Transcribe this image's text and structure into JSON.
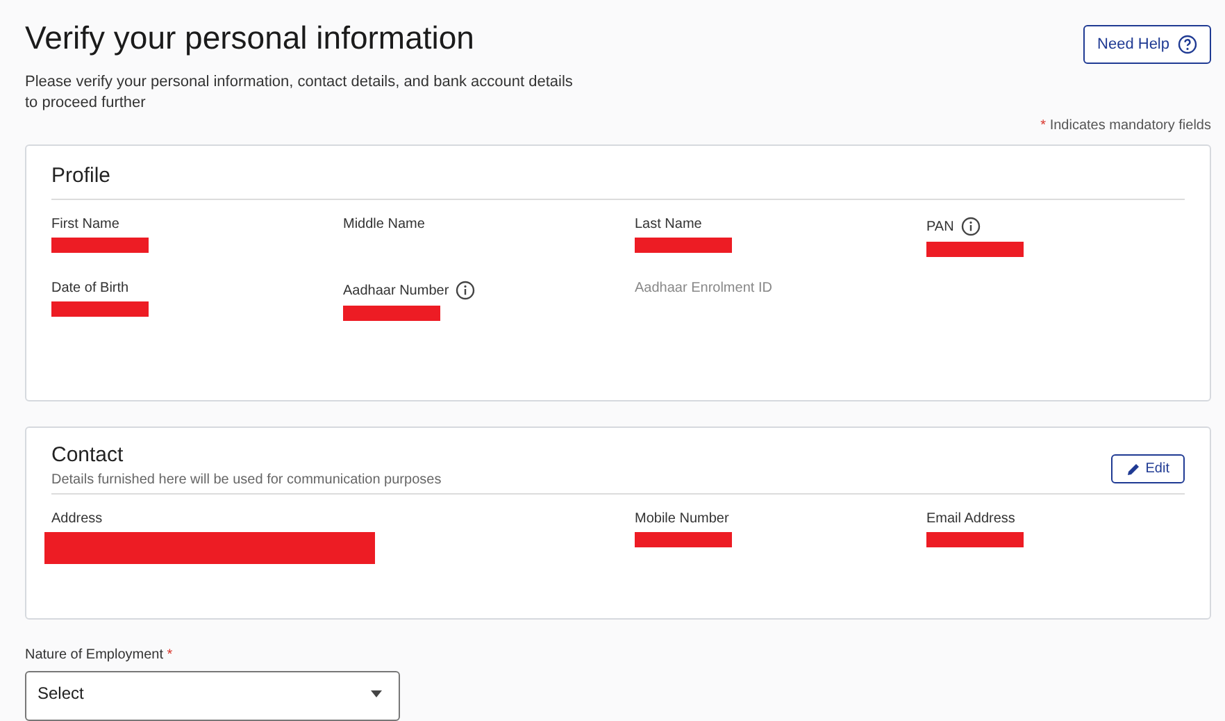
{
  "header": {
    "title": "Verify your personal information",
    "subtitle": "Please verify your personal information, contact details, and bank account details to proceed further",
    "help_button": "Need Help",
    "mandatory_note": {
      "mark": "*",
      "text": "Indicates mandatory fields"
    }
  },
  "profile": {
    "title": "Profile",
    "fields": [
      {
        "label": "First Name",
        "info": false,
        "redacted": true
      },
      {
        "label": "Middle Name",
        "info": false,
        "redacted": false
      },
      {
        "label": "Last Name",
        "info": false,
        "redacted": true
      },
      {
        "label": "PAN",
        "info": true,
        "redacted": true
      },
      {
        "label": "Date of Birth",
        "info": false,
        "redacted": true
      },
      {
        "label": "Aadhaar Number",
        "info": true,
        "redacted": true
      },
      {
        "label": "Aadhaar Enrolment ID",
        "info": false,
        "redacted": false,
        "disabled": true
      }
    ]
  },
  "contact": {
    "title": "Contact",
    "subtitle": "Details furnished here will be used for communication purposes",
    "edit_button": "Edit",
    "fields": [
      {
        "label": "Address",
        "redacted": true,
        "kind": "address"
      },
      {
        "label": "Mobile Number",
        "redacted": true,
        "kind": "text"
      },
      {
        "label": "Email Address",
        "redacted": true,
        "kind": "text"
      }
    ]
  },
  "employment": {
    "label": "Nature of Employment",
    "mark": "*",
    "placeholder": "Select"
  }
}
